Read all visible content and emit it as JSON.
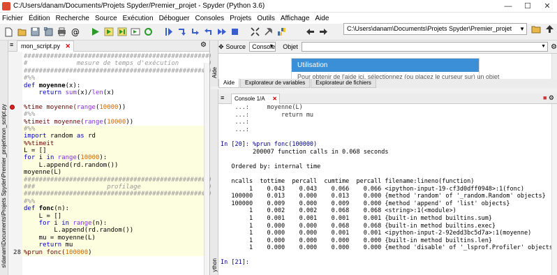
{
  "window": {
    "title": "C:/Users/danam/Documents/Projets Spyder/Premier_projet - Spyder (Python 3.6)",
    "minimize": "—",
    "maximize": "☐",
    "close": "✕"
  },
  "menu": [
    "Fichier",
    "Édition",
    "Recherche",
    "Source",
    "Exécution",
    "Déboguer",
    "Consoles",
    "Projets",
    "Outils",
    "Affichage",
    "Aide"
  ],
  "toolbar": {
    "path": "C:\\Users\\danam\\Documents\\Projets Spyder\\Premier_projet"
  },
  "editor": {
    "vertical_tab": "s\\danam\\Documents\\Projets Spyder\\Premier_projet\\mon_script.py",
    "tab_label": "mon_script.py",
    "current_line_number": "28",
    "lines": {
      "l1": "#######################################################",
      "l2": "#             mesure de temps d'exécution        #",
      "l3": "#######################################################",
      "l4": "#%%",
      "l5_kw": "def ",
      "l5_fn": "moyenne",
      "l5_rest": "(x):",
      "l6_kw": "    return ",
      "l6_bi": "sum",
      "l6_mid": "(x)/",
      "l6_bi2": "len",
      "l6_end": "(x)",
      "l7": "",
      "l8_a": "%time moyenne(",
      "l8_bi": "range",
      "l8_b": "(",
      "l8_num": "10000",
      "l8_c": "))",
      "l9": "#%%",
      "l10_a": "%timeit moyenne(",
      "l10_bi": "range",
      "l10_b": "(",
      "l10_num": "10000",
      "l10_c": "))",
      "l11": "#%%",
      "l12_kw": "import ",
      "l12_rest": "random ",
      "l12_kw2": "as ",
      "l12_rest2": "rd",
      "l13": "%%timeit",
      "l14": "L = []",
      "l15_kw": "for ",
      "l15_a": "i ",
      "l15_kw2": "in ",
      "l15_bi": "range",
      "l15_b": "(",
      "l15_num": "10000",
      "l15_c": "):",
      "l16": "    L.append(rd.random())",
      "l17": "moyenne(L)",
      "l18": "#######################################################",
      "l19": "###                   profilage                  ####",
      "l20": "#######################################################",
      "l21": "#%%",
      "l22_kw": "def ",
      "l22_fn": "fonc",
      "l22_rest": "(n):",
      "l23": "    L = []",
      "l24_kw": "    for ",
      "l24_a": "i ",
      "l24_kw2": "in ",
      "l24_bi": "range",
      "l24_b": "(n):",
      "l25": "        L.append(rd.random())",
      "l26": "    mu = moyenne(L)",
      "l27_kw": "    return ",
      "l27_rest": "mu",
      "l28_a": "%prun fonc(",
      "l28_num": "100000",
      "l28_b": ")"
    }
  },
  "help": {
    "vertical_tab": "Aide",
    "source_label": "Source",
    "source_value": "Console",
    "object_label": "Objet",
    "object_value": "",
    "usage_title": "Utilisation",
    "usage_text": "Pour obtenir de l'aide ici, sélectionnez (ou placez le curseur sur) un objet"
  },
  "pane_tabs": [
    "Aide",
    "Explorateur de variables",
    "Explorateur de fichiers"
  ],
  "console": {
    "vertical_tab": "ython",
    "tab_label": "Console 1/A",
    "lines": [
      "    ...:     moyenne(L)",
      "    ...:         return mu",
      "    ...:",
      "    ...:",
      "",
      "In [20]: %prun fonc(100000)",
      "         200007 function calls in 0.068 seconds",
      "",
      "   Ordered by: internal time",
      "",
      "   ncalls  tottime  percall  cumtime  percall filename:lineno(function)",
      "        1    0.043    0.043    0.066    0.066 <ipython-input-19-cf3d0dff0948>:1(fonc)",
      "   100000    0.013    0.000    0.013    0.000 {method 'random' of '_random.Random' objects}",
      "   100000    0.009    0.000    0.009    0.000 {method 'append' of 'list' objects}",
      "        1    0.002    0.002    0.068    0.068 <string>:1(<module>)",
      "        1    0.001    0.001    0.001    0.001 {built-in method builtins.sum}",
      "        1    0.000    0.000    0.068    0.068 {built-in method builtins.exec}",
      "        1    0.000    0.000    0.001    0.001 <ipython-input-2-92edd3bc5d7a>:1(moyenne)",
      "        1    0.000    0.000    0.000    0.000 {built-in method builtins.len}",
      "        1    0.000    0.000    0.000    0.000 {method 'disable' of '_lsprof.Profiler' objects}",
      "",
      "In [21]:"
    ]
  }
}
